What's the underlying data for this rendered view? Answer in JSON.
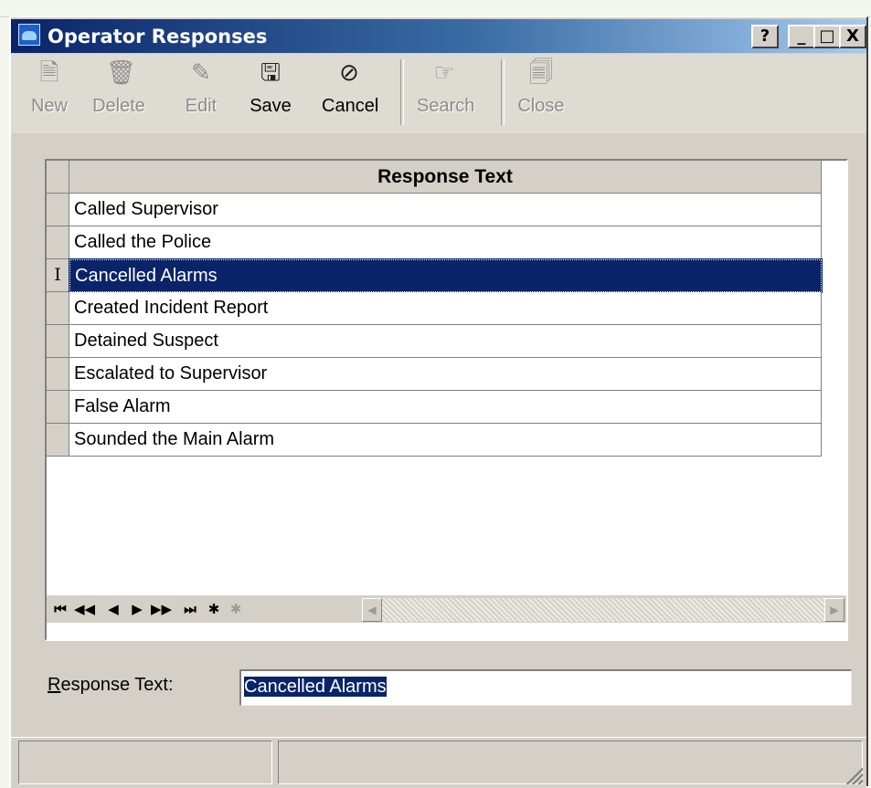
{
  "window": {
    "title": "Operator Responses",
    "controls": {
      "help": "?",
      "minimize": "_",
      "maximize": "□",
      "close": "X"
    }
  },
  "toolbar": {
    "new": {
      "label": "New",
      "icon": "new-document-icon",
      "enabled": false
    },
    "delete": {
      "label": "Delete",
      "icon": "trash-icon",
      "enabled": false
    },
    "edit": {
      "label": "Edit",
      "icon": "edit-document-icon",
      "enabled": false
    },
    "save": {
      "label": "Save",
      "icon": "save-icon",
      "enabled": true
    },
    "cancel": {
      "label": "Cancel",
      "icon": "cancel-icon",
      "enabled": true
    },
    "search": {
      "label": "Search",
      "icon": "search-pointer-icon",
      "enabled": false
    },
    "close": {
      "label": "Close",
      "icon": "close-document-icon",
      "enabled": false
    }
  },
  "grid": {
    "column_header": "Response Text",
    "rows": [
      {
        "text": "Called Supervisor",
        "selected": false,
        "indicator": ""
      },
      {
        "text": "Called the Police",
        "selected": false,
        "indicator": ""
      },
      {
        "text": "Cancelled Alarms",
        "selected": true,
        "indicator": "I"
      },
      {
        "text": "Created Incident Report",
        "selected": false,
        "indicator": ""
      },
      {
        "text": "Detained Suspect",
        "selected": false,
        "indicator": ""
      },
      {
        "text": "Escalated to Supervisor",
        "selected": false,
        "indicator": ""
      },
      {
        "text": "False Alarm",
        "selected": false,
        "indicator": ""
      },
      {
        "text": "Sounded the Main Alarm",
        "selected": false,
        "indicator": ""
      }
    ],
    "navigator": {
      "first": "⏮",
      "prior_page": "◀◀",
      "prior": "◀",
      "next": "▶",
      "next_page": "▶▶",
      "last": "⏭",
      "insert": "✱",
      "post": "✱"
    },
    "scrollbar": {
      "left": "◀",
      "right": "▶"
    }
  },
  "form": {
    "response_label_prefix": "R",
    "response_label_rest": "esponse Text:",
    "response_value": "Cancelled Alarms"
  },
  "colors": {
    "selection": "#0a246a",
    "title_start": "#0a246a",
    "title_end": "#a6caf0",
    "face": "#d4d0c8"
  }
}
